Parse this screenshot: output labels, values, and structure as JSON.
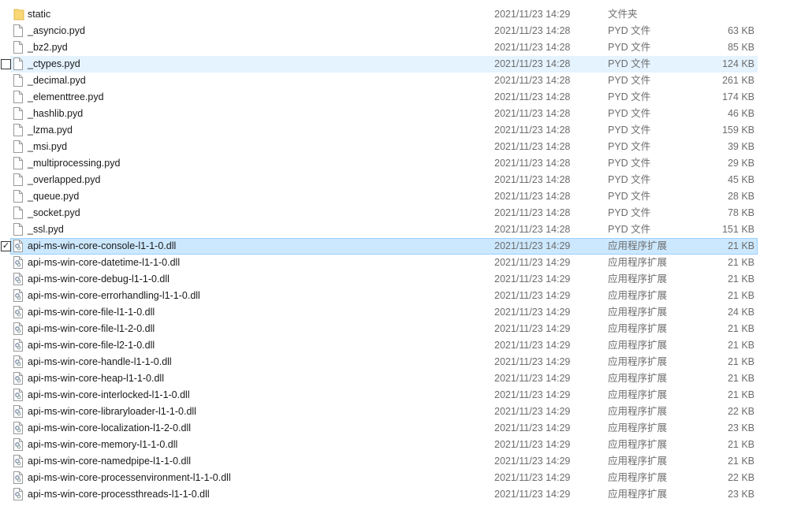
{
  "files": [
    {
      "name": "static",
      "date": "2021/11/23 14:29",
      "type": "文件夹",
      "size": "",
      "icon": "folder-icon"
    },
    {
      "name": "_asyncio.pyd",
      "date": "2021/11/23 14:28",
      "type": "PYD 文件",
      "size": "63 KB",
      "icon": "file-icon"
    },
    {
      "name": "_bz2.pyd",
      "date": "2021/11/23 14:28",
      "type": "PYD 文件",
      "size": "85 KB",
      "icon": "file-icon"
    },
    {
      "name": "_ctypes.pyd",
      "date": "2021/11/23 14:28",
      "type": "PYD 文件",
      "size": "124 KB",
      "icon": "file-icon",
      "state": "hover"
    },
    {
      "name": "_decimal.pyd",
      "date": "2021/11/23 14:28",
      "type": "PYD 文件",
      "size": "261 KB",
      "icon": "file-icon"
    },
    {
      "name": "_elementtree.pyd",
      "date": "2021/11/23 14:28",
      "type": "PYD 文件",
      "size": "174 KB",
      "icon": "file-icon"
    },
    {
      "name": "_hashlib.pyd",
      "date": "2021/11/23 14:28",
      "type": "PYD 文件",
      "size": "46 KB",
      "icon": "file-icon"
    },
    {
      "name": "_lzma.pyd",
      "date": "2021/11/23 14:28",
      "type": "PYD 文件",
      "size": "159 KB",
      "icon": "file-icon"
    },
    {
      "name": "_msi.pyd",
      "date": "2021/11/23 14:28",
      "type": "PYD 文件",
      "size": "39 KB",
      "icon": "file-icon"
    },
    {
      "name": "_multiprocessing.pyd",
      "date": "2021/11/23 14:28",
      "type": "PYD 文件",
      "size": "29 KB",
      "icon": "file-icon"
    },
    {
      "name": "_overlapped.pyd",
      "date": "2021/11/23 14:28",
      "type": "PYD 文件",
      "size": "45 KB",
      "icon": "file-icon"
    },
    {
      "name": "_queue.pyd",
      "date": "2021/11/23 14:28",
      "type": "PYD 文件",
      "size": "28 KB",
      "icon": "file-icon"
    },
    {
      "name": "_socket.pyd",
      "date": "2021/11/23 14:28",
      "type": "PYD 文件",
      "size": "78 KB",
      "icon": "file-icon"
    },
    {
      "name": "_ssl.pyd",
      "date": "2021/11/23 14:28",
      "type": "PYD 文件",
      "size": "151 KB",
      "icon": "file-icon"
    },
    {
      "name": "api-ms-win-core-console-l1-1-0.dll",
      "date": "2021/11/23 14:29",
      "type": "应用程序扩展",
      "size": "21 KB",
      "icon": "dll-icon",
      "state": "selected"
    },
    {
      "name": "api-ms-win-core-datetime-l1-1-0.dll",
      "date": "2021/11/23 14:29",
      "type": "应用程序扩展",
      "size": "21 KB",
      "icon": "dll-icon"
    },
    {
      "name": "api-ms-win-core-debug-l1-1-0.dll",
      "date": "2021/11/23 14:29",
      "type": "应用程序扩展",
      "size": "21 KB",
      "icon": "dll-icon"
    },
    {
      "name": "api-ms-win-core-errorhandling-l1-1-0.dll",
      "date": "2021/11/23 14:29",
      "type": "应用程序扩展",
      "size": "21 KB",
      "icon": "dll-icon"
    },
    {
      "name": "api-ms-win-core-file-l1-1-0.dll",
      "date": "2021/11/23 14:29",
      "type": "应用程序扩展",
      "size": "24 KB",
      "icon": "dll-icon"
    },
    {
      "name": "api-ms-win-core-file-l1-2-0.dll",
      "date": "2021/11/23 14:29",
      "type": "应用程序扩展",
      "size": "21 KB",
      "icon": "dll-icon"
    },
    {
      "name": "api-ms-win-core-file-l2-1-0.dll",
      "date": "2021/11/23 14:29",
      "type": "应用程序扩展",
      "size": "21 KB",
      "icon": "dll-icon"
    },
    {
      "name": "api-ms-win-core-handle-l1-1-0.dll",
      "date": "2021/11/23 14:29",
      "type": "应用程序扩展",
      "size": "21 KB",
      "icon": "dll-icon"
    },
    {
      "name": "api-ms-win-core-heap-l1-1-0.dll",
      "date": "2021/11/23 14:29",
      "type": "应用程序扩展",
      "size": "21 KB",
      "icon": "dll-icon"
    },
    {
      "name": "api-ms-win-core-interlocked-l1-1-0.dll",
      "date": "2021/11/23 14:29",
      "type": "应用程序扩展",
      "size": "21 KB",
      "icon": "dll-icon"
    },
    {
      "name": "api-ms-win-core-libraryloader-l1-1-0.dll",
      "date": "2021/11/23 14:29",
      "type": "应用程序扩展",
      "size": "22 KB",
      "icon": "dll-icon"
    },
    {
      "name": "api-ms-win-core-localization-l1-2-0.dll",
      "date": "2021/11/23 14:29",
      "type": "应用程序扩展",
      "size": "23 KB",
      "icon": "dll-icon"
    },
    {
      "name": "api-ms-win-core-memory-l1-1-0.dll",
      "date": "2021/11/23 14:29",
      "type": "应用程序扩展",
      "size": "21 KB",
      "icon": "dll-icon"
    },
    {
      "name": "api-ms-win-core-namedpipe-l1-1-0.dll",
      "date": "2021/11/23 14:29",
      "type": "应用程序扩展",
      "size": "21 KB",
      "icon": "dll-icon"
    },
    {
      "name": "api-ms-win-core-processenvironment-l1-1-0.dll",
      "date": "2021/11/23 14:29",
      "type": "应用程序扩展",
      "size": "22 KB",
      "icon": "dll-icon"
    },
    {
      "name": "api-ms-win-core-processthreads-l1-1-0.dll",
      "date": "2021/11/23 14:29",
      "type": "应用程序扩展",
      "size": "23 KB",
      "icon": "dll-icon"
    }
  ],
  "colors": {
    "hover": "#e5f3ff",
    "selected": "#cce8ff",
    "selected_border": "#99d1ff",
    "folder": "#f8d775"
  }
}
